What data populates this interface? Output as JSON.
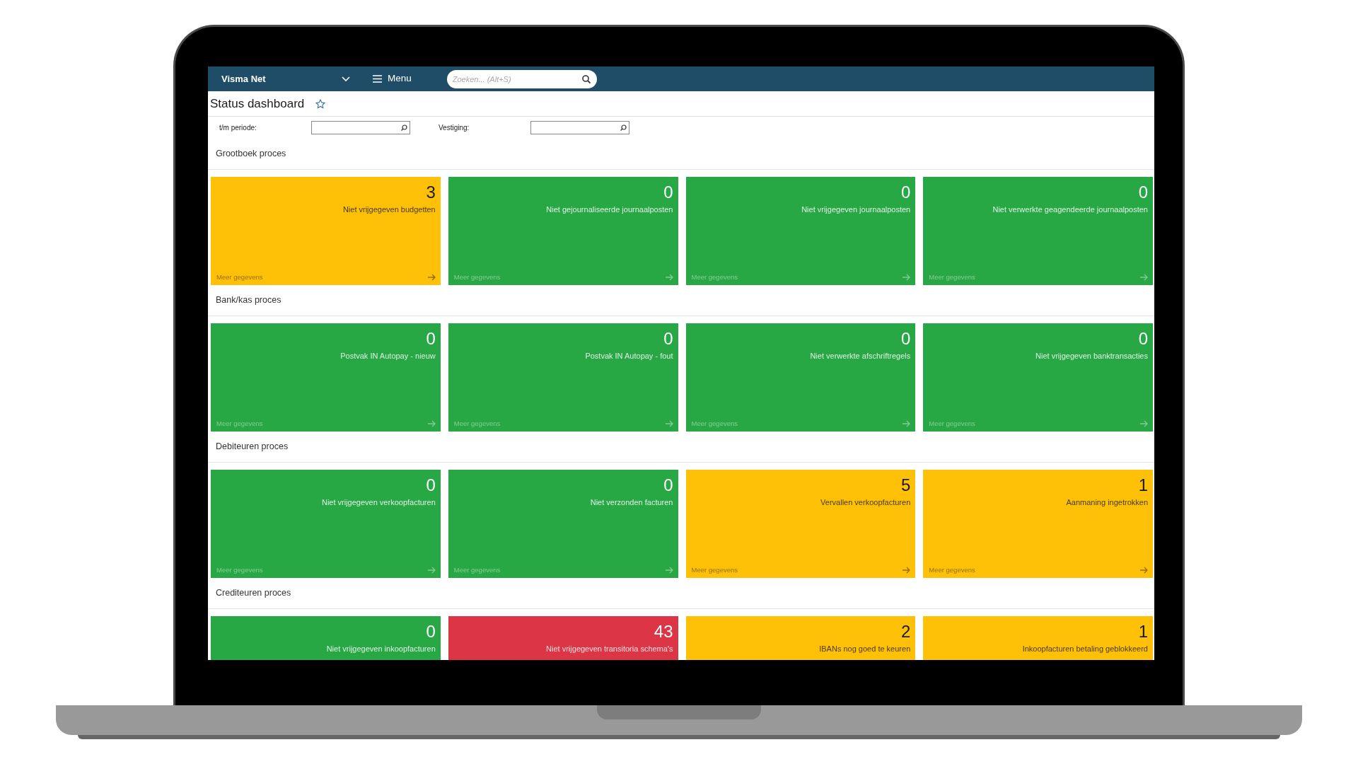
{
  "topbar": {
    "company": "Visma Net",
    "menu": "Menu",
    "search": {
      "placeholder": "Zoeken... (Alt+S)"
    }
  },
  "page": {
    "title": "Status dashboard",
    "favorite": false
  },
  "filters": [
    {
      "label": "t/m periode:"
    },
    {
      "label": "Vestiging:"
    }
  ],
  "sections": [
    {
      "title": "Grootboek proces",
      "tiles": [
        {
          "count": "3",
          "label": "Niet vrijgegeven budgetten",
          "link": "Meer gegevens",
          "color": "#ffc107"
        },
        {
          "count": "0",
          "label": "Niet gejournaliseerde journaalposten",
          "link": "Meer gegevens",
          "color": "#28a745"
        },
        {
          "count": "0",
          "label": "Niet vrijgegeven journaalposten",
          "link": "Meer gegevens",
          "color": "#28a745"
        },
        {
          "count": "0",
          "label": "Niet verwerkte geagendeerde journaalposten",
          "link": "Meer gegevens",
          "color": "#28a745"
        }
      ]
    },
    {
      "title": "Bank/kas proces",
      "tiles": [
        {
          "count": "0",
          "label": "Postvak IN Autopay - nieuw",
          "link": "Meer gegevens",
          "color": "#28a745"
        },
        {
          "count": "0",
          "label": "Postvak IN Autopay - fout",
          "link": "Meer gegevens",
          "color": "#28a745"
        },
        {
          "count": "0",
          "label": "Niet verwerkte afschriftregels",
          "link": "Meer gegevens",
          "color": "#28a745"
        },
        {
          "count": "0",
          "label": "Niet vrijgegeven banktransacties",
          "link": "Meer gegevens",
          "color": "#28a745"
        }
      ]
    },
    {
      "title": "Debiteuren proces",
      "tiles": [
        {
          "count": "0",
          "label": "Niet vrijgegeven verkoopfacturen",
          "link": "Meer gegevens",
          "color": "#28a745"
        },
        {
          "count": "0",
          "label": "Niet verzonden facturen",
          "link": "Meer gegevens",
          "color": "#28a745"
        },
        {
          "count": "5",
          "label": "Vervallen verkoopfacturen",
          "link": "Meer gegevens",
          "color": "#ffc107"
        },
        {
          "count": "1",
          "label": "Aanmaning ingetrokken",
          "link": "Meer gegevens",
          "color": "#ffc107"
        }
      ]
    },
    {
      "title": "Crediteuren proces",
      "tiles": [
        {
          "count": "0",
          "label": "Niet vrijgegeven inkoopfacturen",
          "color": "#28a745"
        },
        {
          "count": "43",
          "label": "Niet vrijgegeven transitoria schema's",
          "color": "#dc3545"
        },
        {
          "count": "2",
          "label": "IBANs nog goed te keuren",
          "color": "#ffc107"
        },
        {
          "count": "1",
          "label": "Inkoopfacturen betaling geblokkeerd",
          "color": "#ffc107"
        }
      ]
    }
  ]
}
